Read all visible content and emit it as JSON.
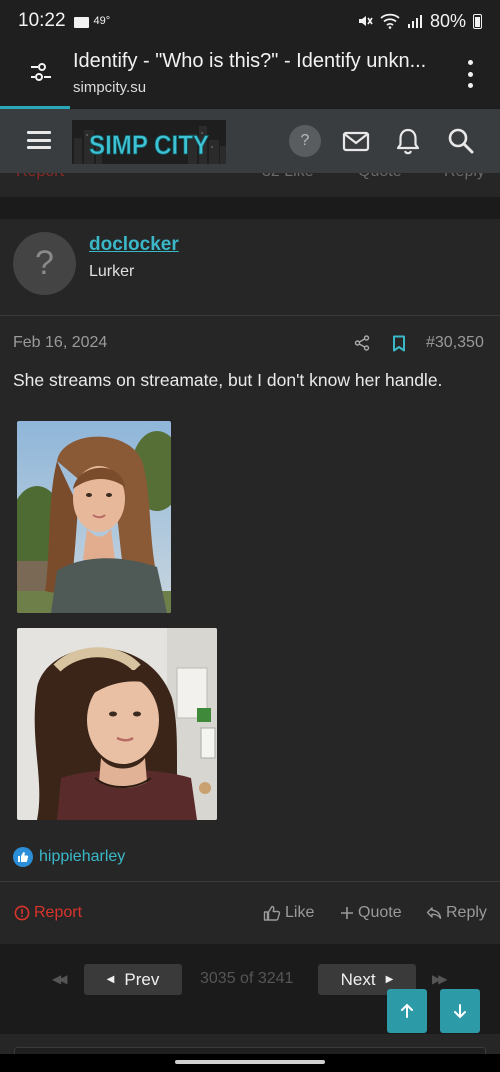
{
  "status_bar": {
    "time": "10:22",
    "temperature": "49°",
    "battery": "80%"
  },
  "browser": {
    "page_title": "Identify - \"Who is this?\" - Identify unkn...",
    "domain": "simpcity.su"
  },
  "site_header": {
    "logo_text": "SIMP CITY",
    "help_label": "?"
  },
  "previous_post_footer": {
    "like": "32 Like",
    "quote": "Quote",
    "reply": "Reply",
    "report": "Report"
  },
  "post": {
    "author": {
      "name": "doclocker",
      "role": "Lurker",
      "avatar_glyph": "?"
    },
    "date": "Feb 16, 2024",
    "post_number": "#30,350",
    "body": "She streams on streamate, but I don't know her handle.",
    "reaction": {
      "user": "hippieharley"
    },
    "actions": {
      "report": "Report",
      "like": "Like",
      "quote": "Quote",
      "reply": "Reply"
    }
  },
  "pagination": {
    "prev_label": "Prev",
    "next_label": "Next",
    "count": "3035 of 3241"
  },
  "colors": {
    "accent": "#3ab8c8",
    "report": "#d9342b",
    "header": "#3a3d40",
    "card": "#262626",
    "background": "#1b1b1b"
  }
}
